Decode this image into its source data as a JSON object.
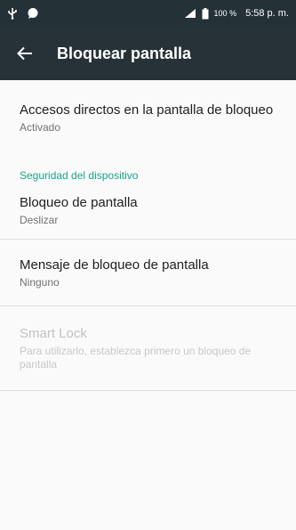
{
  "status_bar": {
    "battery_percent": "100 %",
    "time": "5:58 p. m."
  },
  "toolbar": {
    "title": "Bloquear pantalla"
  },
  "preferences": {
    "shortcuts": {
      "title": "Accesos directos en la pantalla de bloqueo",
      "summary": "Activado"
    },
    "category": "Seguridad del dispositivo",
    "screen_lock": {
      "title": "Bloqueo de pantalla",
      "summary": "Deslizar"
    },
    "lock_message": {
      "title": "Mensaje de bloqueo de pantalla",
      "summary": "Ninguno"
    },
    "smart_lock": {
      "title": "Smart Lock",
      "summary": "Para utilizarlo, establezca primero un bloqueo de pantalla"
    }
  },
  "colors": {
    "toolbar": "#263238",
    "accent": "#1aa48c"
  },
  "icons": [
    "usb-icon",
    "notification-icon",
    "signal-icon",
    "battery-icon",
    "back-arrow-icon"
  ]
}
